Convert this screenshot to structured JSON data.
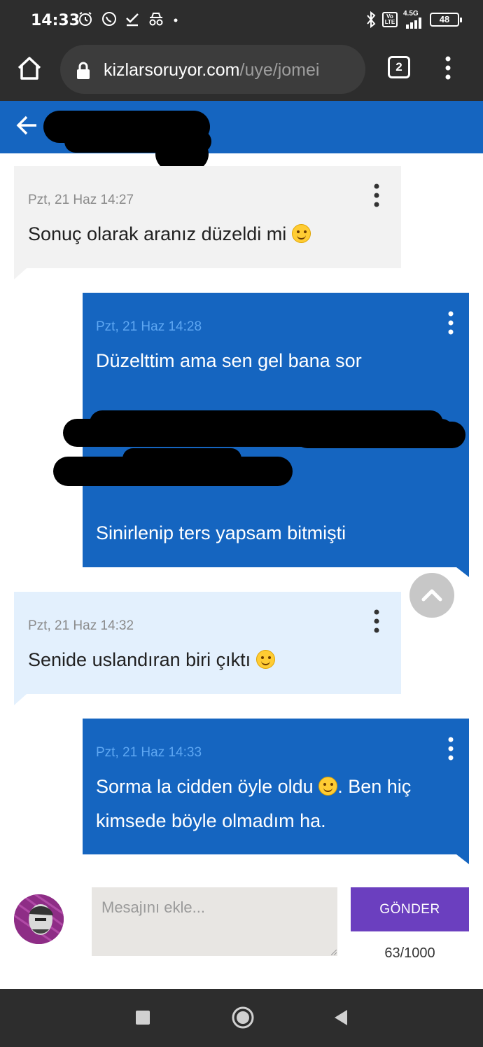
{
  "status_bar": {
    "time": "14:33",
    "network_label": "4.5G",
    "volte_label": "Vo LTE",
    "battery": "48"
  },
  "browser": {
    "url_domain": "kizlarsoruyor.com",
    "url_path": "/uye/jomei",
    "tab_count": "2"
  },
  "messages": [
    {
      "time": "Pzt, 21 Haz 14:27",
      "text": "Sonuç olarak aranız düzeldi mi",
      "emoji": "smiling-face-emoji"
    },
    {
      "time": "Pzt, 21 Haz 14:28",
      "line1": "Düzelttim ama sen gel bana sor",
      "line2": "Sinirlenip ters yapsam bitmişti"
    },
    {
      "time": "Pzt, 21 Haz 14:32",
      "text": "Senide uslandıran biri çıktı",
      "emoji": "grinning-face-emoji"
    },
    {
      "time": "Pzt, 21 Haz 14:33",
      "text_before_emoji": "Sorma la cidden öyle oldu",
      "text_after_emoji": ". Ben hiç",
      "line2": "kimsede böyle olmadım ha."
    }
  ],
  "composer": {
    "placeholder": "Mesajını ekle...",
    "send_label": "GÖNDER",
    "char_count": "63/1000"
  },
  "colors": {
    "header_blue": "#1565c0",
    "sent_bubble": "#1565c0",
    "received_bubble": "#f2f2f2",
    "received_bubble_alt": "#e3f0fd",
    "send_button": "#6b3fbf",
    "system_bar": "#2d2d2d"
  }
}
